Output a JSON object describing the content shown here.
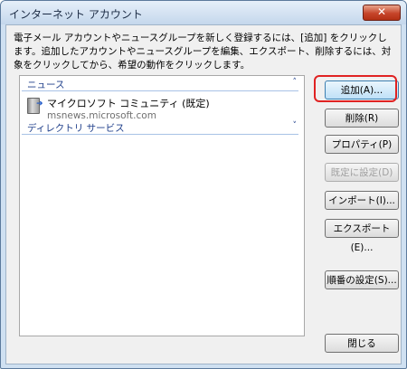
{
  "window": {
    "title": "インターネット アカウント",
    "close_glyph": "✕"
  },
  "description": "電子メール アカウントやニュースグループを新しく登録するには、[追加] をクリックします。追加したアカウントやニュースグループを編集、エクスポート、削除するには、対象をクリックしてから、希望の動作をクリックします。",
  "list": {
    "groups": [
      {
        "label": "ニュース",
        "chevron": "˄"
      },
      {
        "label": "ディレクトリ サービス",
        "chevron": "˅"
      }
    ],
    "accounts": [
      {
        "name": "マイクロソフト コミュニティ (既定)",
        "server": "msnews.microsoft.com",
        "icon": "server-icon"
      }
    ]
  },
  "buttons": {
    "add": "追加(A)...",
    "delete": "削除(R)",
    "properties": "プロパティ(P)",
    "set_default": "既定に設定(D)",
    "import": "インポート(I)...",
    "export": "エクスポート(E)...",
    "order": "順番の設定(S)...",
    "close": "閉じる"
  },
  "colors": {
    "highlight": "#e02222",
    "group_text": "#1e3e8a"
  }
}
